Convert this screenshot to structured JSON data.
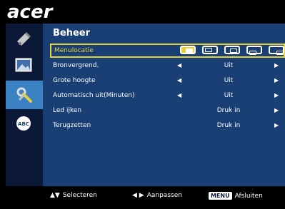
{
  "brand": {
    "logo_text": "acer"
  },
  "panel": {
    "title": "Beheer"
  },
  "sidebar": {
    "items": [
      {
        "icon": "image-adjust-icon",
        "active": false
      },
      {
        "icon": "picture-icon",
        "active": false
      },
      {
        "icon": "tools-icon",
        "active": true
      },
      {
        "icon": "abc-language-icon",
        "active": false
      }
    ]
  },
  "menu": {
    "rows": [
      {
        "label": "Menulocatie",
        "selected": true
      },
      {
        "label": "Bronvergrend.",
        "value": "Uit"
      },
      {
        "label": "Grote hoogte",
        "value": "Uit"
      },
      {
        "label": "Automatisch uit(Minuten)",
        "value": "Uit"
      },
      {
        "label": "Led ijken",
        "value": "Druk in"
      },
      {
        "label": "Terugzetten",
        "value": "Druk in"
      }
    ]
  },
  "footer": {
    "select_label": "Selecteren",
    "adjust_label": "Aanpassen",
    "menu_key": "MENU",
    "exit_label": "Afsluiten"
  },
  "colors": {
    "panel_bg": "#1a3f74",
    "sidebar_bg": "#0c1838",
    "highlight": "#e6d23a",
    "active_icon_bg": "#3a82c4"
  }
}
